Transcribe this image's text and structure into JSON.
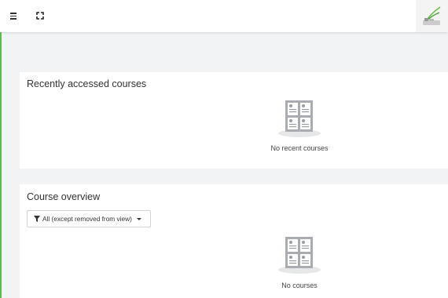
{
  "header": {
    "menu_icon": "hamburger-icon",
    "fullscreen_icon": "expand-icon",
    "logo_icon": "site-logo"
  },
  "recent_courses": {
    "title": "Recently accessed courses",
    "empty_icon": "courses-empty-icon",
    "empty_message": "No recent courses"
  },
  "course_overview": {
    "title": "Course overview",
    "filter": {
      "icon": "filter-icon",
      "selected_label": "All (except removed from view)",
      "caret_icon": "caret-down-icon"
    },
    "empty_icon": "courses-empty-icon",
    "empty_message": "No courses"
  },
  "colors": {
    "accent": "#5cb85c",
    "background": "#f1f3f4",
    "card": "#ffffff",
    "icon_gray": "#a9adb1"
  }
}
